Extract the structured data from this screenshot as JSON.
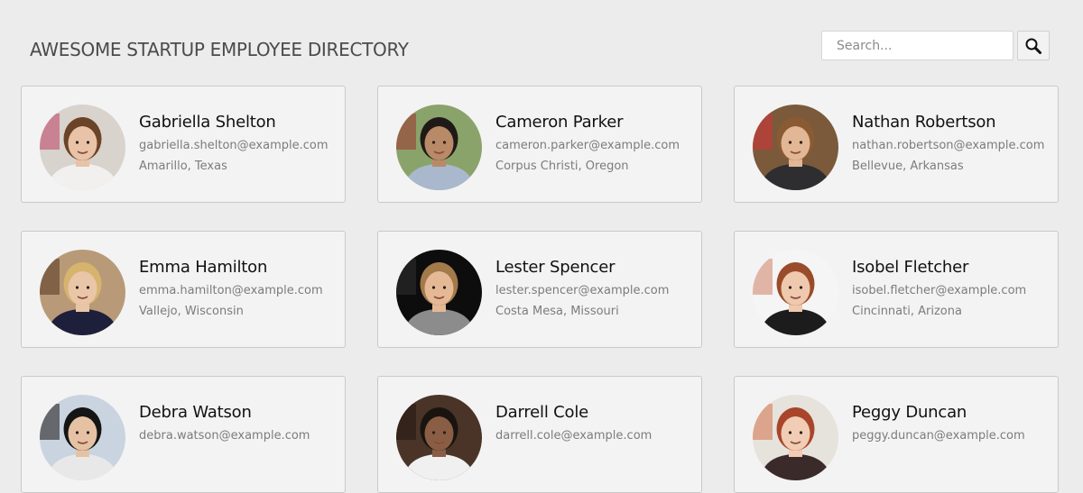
{
  "header": {
    "title": "AWESOME STARTUP EMPLOYEE DIRECTORY"
  },
  "search": {
    "placeholder": "Search...",
    "button_icon": "search-icon"
  },
  "colors": {
    "background": "#ececec",
    "card_background": "#f3f3f3",
    "card_border": "#c9c9c9",
    "name_text": "#111111",
    "secondary_text": "#7c7c7c"
  },
  "employees": [
    {
      "name": "Gabriella Shelton",
      "email": "gabriella.shelton@example.com",
      "location": "Amarillo, Texas",
      "avatar": {
        "bg": "#d8d3cc",
        "skin": "#e8c3a8",
        "hair": "#6b4428",
        "shirt": "#f2f0ee",
        "accent": "#c2607a"
      }
    },
    {
      "name": "Cameron Parker",
      "email": "cameron.parker@example.com",
      "location": "Corpus Christi, Oregon",
      "avatar": {
        "bg": "#8aa36a",
        "skin": "#b98a68",
        "hair": "#1f1a17",
        "shirt": "#a9b8cc",
        "accent": "#9a4a3c"
      }
    },
    {
      "name": "Nathan Robertson",
      "email": "nathan.robertson@example.com",
      "location": "Bellevue, Arkansas",
      "avatar": {
        "bg": "#7a5a3a",
        "skin": "#e2b795",
        "hair": "#8a5a32",
        "shirt": "#2e2e30",
        "accent": "#c23a3a"
      }
    },
    {
      "name": "Emma Hamilton",
      "email": "emma.hamilton@example.com",
      "location": "Vallejo, Wisconsin",
      "avatar": {
        "bg": "#b89a78",
        "skin": "#eac6a8",
        "hair": "#d7b46e",
        "shirt": "#1e1f3a",
        "accent": "#6a4a32"
      }
    },
    {
      "name": "Lester Spencer",
      "email": "lester.spencer@example.com",
      "location": "Costa Mesa, Missouri",
      "avatar": {
        "bg": "#0d0d0d",
        "skin": "#e5b896",
        "hair": "#a37a4a",
        "shirt": "#8c8c8c",
        "accent": "#2a2a2a"
      }
    },
    {
      "name": "Isobel Fletcher",
      "email": "isobel.fletcher@example.com",
      "location": "Cincinnati, Arizona",
      "avatar": {
        "bg": "#f5f5f5",
        "skin": "#efc9ae",
        "hair": "#9a4b2a",
        "shirt": "#1c1c1c",
        "accent": "#d89a84"
      }
    },
    {
      "name": "Debra Watson",
      "email": "debra.watson@example.com",
      "location": "",
      "avatar": {
        "bg": "#c9d4e0",
        "skin": "#e6c2a4",
        "hair": "#151515",
        "shirt": "#e8e8e8",
        "accent": "#3a3a3a"
      }
    },
    {
      "name": "Darrell Cole",
      "email": "darrell.cole@example.com",
      "location": "",
      "avatar": {
        "bg": "#4a3428",
        "skin": "#8a5e44",
        "hair": "#1a1410",
        "shirt": "#f0f0f0",
        "accent": "#2a1c14"
      }
    },
    {
      "name": "Peggy Duncan",
      "email": "peggy.duncan@example.com",
      "location": "",
      "avatar": {
        "bg": "#e6e2dc",
        "skin": "#f0cdb4",
        "hair": "#a8452a",
        "shirt": "#3a2a2a",
        "accent": "#d88a6a"
      }
    }
  ]
}
